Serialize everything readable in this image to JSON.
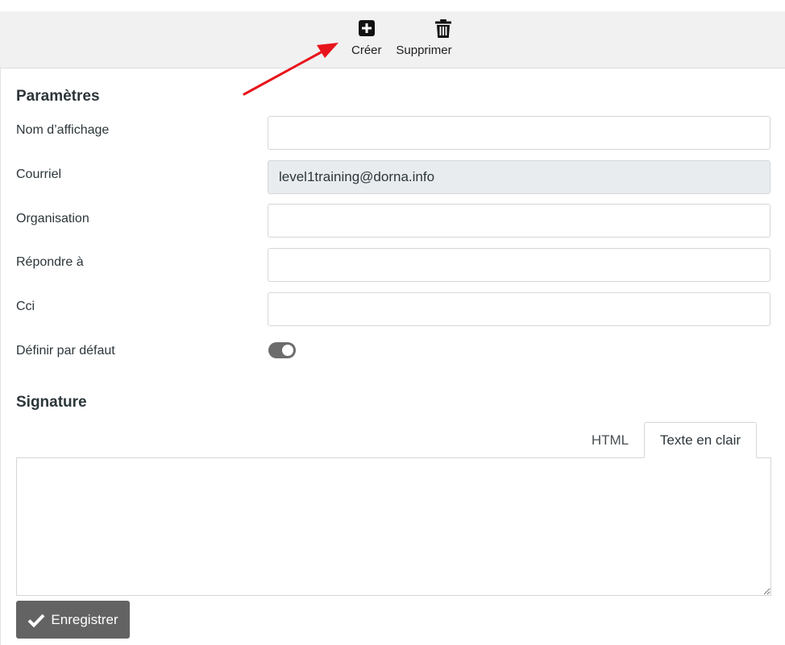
{
  "toolbar": {
    "create_label": "Créer",
    "delete_label": "Supprimer"
  },
  "parameters": {
    "title": "Paramètres",
    "fields": [
      {
        "label": "Nom d’affichage",
        "value": ""
      },
      {
        "label": "Courriel",
        "value": "level1training@dorna.info"
      },
      {
        "label": "Organisation",
        "value": ""
      },
      {
        "label": "Répondre à",
        "value": ""
      },
      {
        "label": "Cci",
        "value": ""
      }
    ],
    "default_label": "Définir par défaut"
  },
  "signature": {
    "title": "Signature",
    "tabs": [
      {
        "label": "HTML"
      },
      {
        "label": "Texte en clair"
      }
    ],
    "value": ""
  },
  "save_label": "Enregistrer",
  "colors": {
    "toolbar_bg": "#f1f1f1",
    "button_bg": "#636363",
    "readonly_bg": "#e9ecef",
    "annotation_arrow": "#e8141b"
  },
  "icons": {
    "create": "plus-square-icon",
    "delete": "trash-icon",
    "save": "check-icon"
  }
}
